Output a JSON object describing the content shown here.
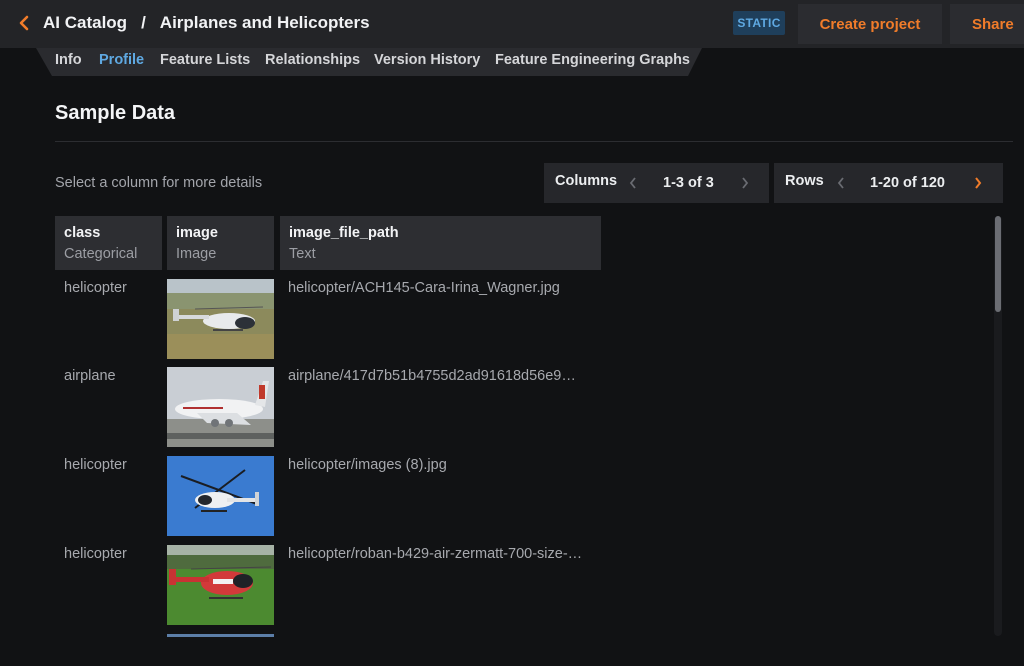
{
  "header": {
    "back_label": "‹",
    "catalog_label": "AI Catalog",
    "separator": "/",
    "dataset_title": "Airplanes and Helicopters",
    "badge": "STATIC",
    "create_project_label": "Create project",
    "share_label": "Share"
  },
  "tabs": [
    {
      "label": "Info",
      "active": false
    },
    {
      "label": "Profile",
      "active": true
    },
    {
      "label": "Feature Lists",
      "active": false
    },
    {
      "label": "Relationships",
      "active": false
    },
    {
      "label": "Version History",
      "active": false
    },
    {
      "label": "Feature Engineering Graphs",
      "active": false
    }
  ],
  "section": {
    "title": "Sample Data",
    "hint": "Select a column for more details"
  },
  "pagers": {
    "columns": {
      "label": "Columns",
      "range": "1-3 of 3"
    },
    "rows": {
      "label": "Rows",
      "range": "1-20 of 120"
    }
  },
  "columns": [
    {
      "name": "class",
      "type": "Categorical"
    },
    {
      "name": "image",
      "type": "Image"
    },
    {
      "name": "image_file_path",
      "type": "Text"
    }
  ],
  "rows": [
    {
      "class": "helicopter",
      "thumb": "helicopter-on-grass",
      "path": "helicopter/ACH145-Cara-Irina_Wagner.jpg"
    },
    {
      "class": "airplane",
      "thumb": "airliner-on-runway",
      "path": "airplane/417d7b51b4755d2ad91618d56e9…"
    },
    {
      "class": "helicopter",
      "thumb": "helicopter-in-blue-sky",
      "path": "helicopter/images (8).jpg"
    },
    {
      "class": "helicopter",
      "thumb": "red-helicopter-on-field",
      "path": "helicopter/roban-b429-air-zermatt-700-size-…"
    }
  ],
  "colors": {
    "accent_orange": "#f07c2a",
    "accent_blue": "#5fa9e2",
    "background": "#111214"
  }
}
